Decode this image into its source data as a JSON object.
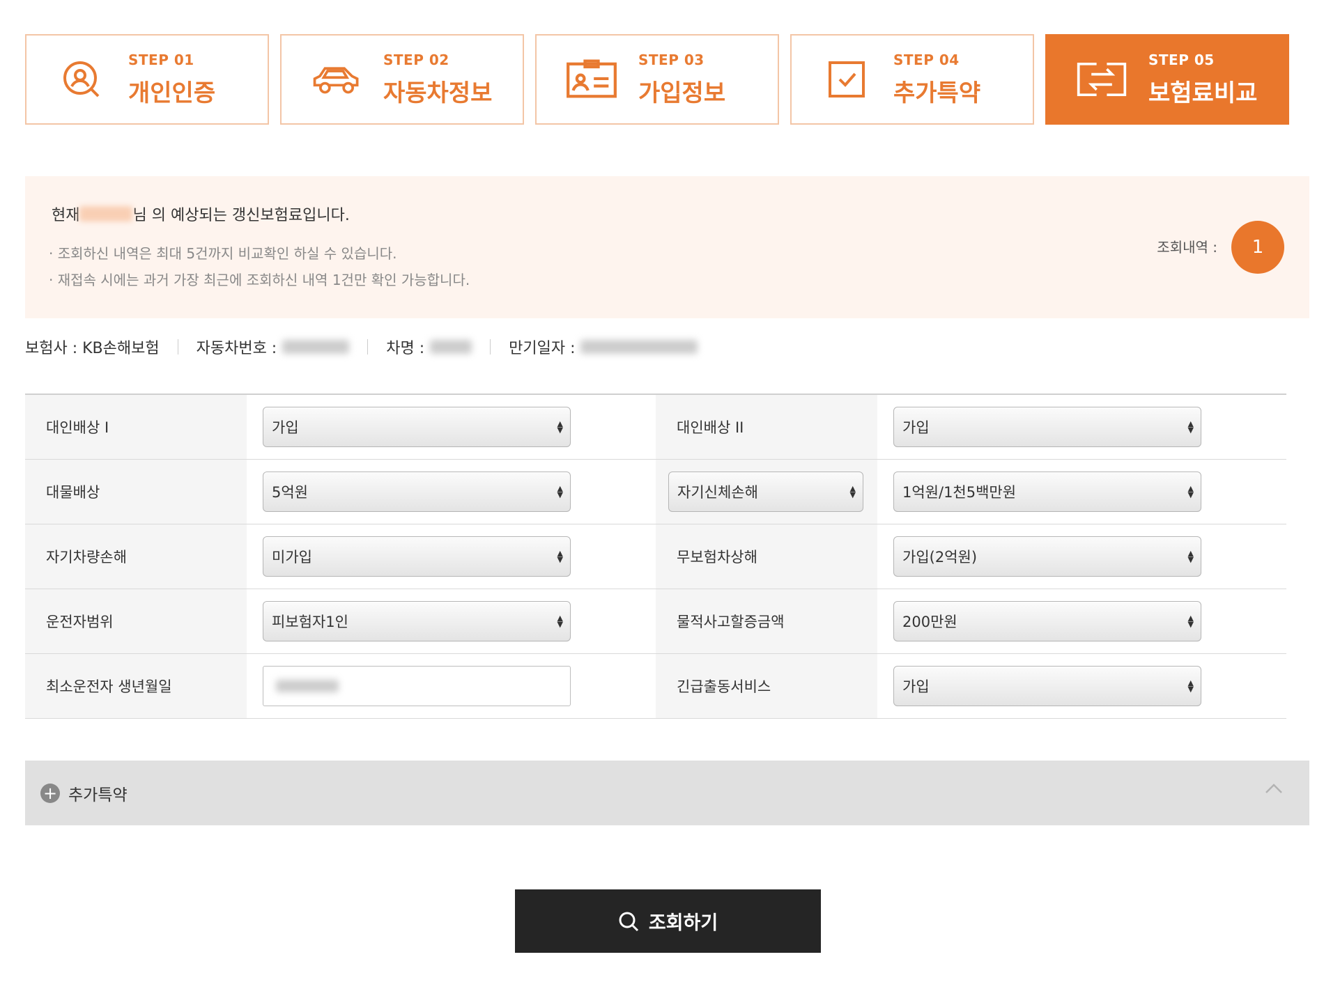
{
  "steps": [
    {
      "num": "STEP 01",
      "name": "개인인증",
      "icon": "user-search-icon",
      "active": false
    },
    {
      "num": "STEP 02",
      "name": "자동차정보",
      "icon": "car-icon",
      "active": false
    },
    {
      "num": "STEP 03",
      "name": "가입정보",
      "icon": "id-card-icon",
      "active": false
    },
    {
      "num": "STEP 04",
      "name": "추가특약",
      "icon": "checkbox-icon",
      "active": false
    },
    {
      "num": "STEP 05",
      "name": "보험료비교",
      "icon": "compare-icon",
      "active": true
    }
  ],
  "notice": {
    "prefix": "현재",
    "suffix": "님 의 예상되는 갱신보험료입니다.",
    "bullets": [
      "· 조회하신 내역은 최대 5건까지 비교확인 하실 수 있습니다.",
      "· 재접속 시에는 과거 가장 최근에 조회하신 내역 1건만 확인 가능합니다."
    ],
    "history_label": "조회내역 :",
    "history_count": "1"
  },
  "info": {
    "insurer": "보험사 : KB손해보험",
    "car_number_label": "자동차번호 :",
    "car_name_label": "차명 :",
    "expiry_label": "만기일자 :"
  },
  "coverage": {
    "rows": [
      {
        "left_label": "대인배상 I",
        "left_value": "가입",
        "right_label": "대인배상 II",
        "right_value": "가입"
      },
      {
        "left_label": "대물배상",
        "left_value": "5억원",
        "right_label": "자기신체손해",
        "right_value": "1억원/1천5백만원"
      },
      {
        "left_label": "자기차량손해",
        "left_value": "미가입",
        "right_label": "무보험차상해",
        "right_value": "가입(2억원)"
      },
      {
        "left_label": "운전자범위",
        "left_value": "피보험자1인",
        "right_label": "물적사고할증금액",
        "right_value": "200만원"
      },
      {
        "left_label": "최소운전자 생년월일",
        "left_value": "",
        "right_label": "긴급출동서비스",
        "right_value": "가입"
      }
    ]
  },
  "accordion": {
    "label": "추가특약"
  },
  "search": {
    "label": "조회하기"
  },
  "colors": {
    "accent": "#e9772c",
    "accent_light": "#fef4ee",
    "dark": "#252525"
  }
}
